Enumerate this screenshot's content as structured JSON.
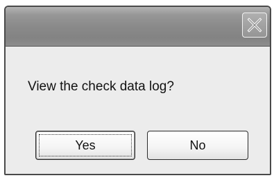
{
  "dialog": {
    "message": "View the check data log?",
    "buttons": {
      "yes_label": "Yes",
      "no_label": "No"
    },
    "titlebar": {
      "close_icon": "close-icon"
    }
  }
}
